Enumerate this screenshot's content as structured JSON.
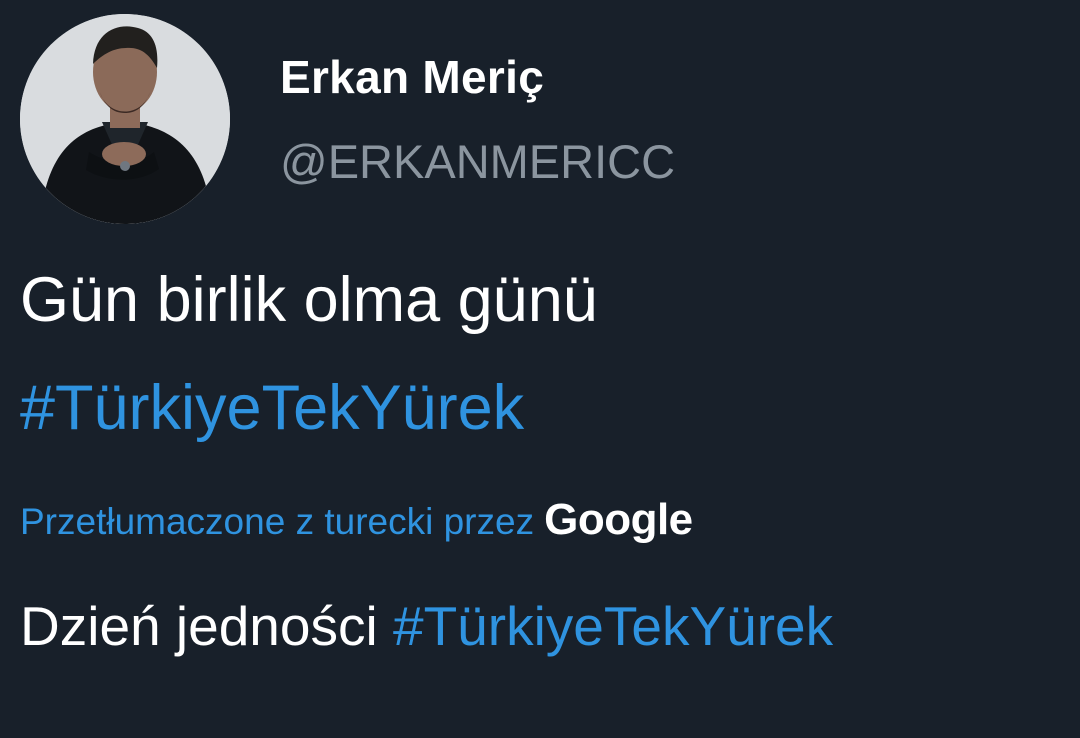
{
  "colors": {
    "background": "#18202a",
    "text": "#ffffff",
    "muted": "#8b959f",
    "link": "#2f93e0"
  },
  "author": {
    "display_name": "Erkan Meriç",
    "handle": "@ERKANMERICC",
    "avatar": "profile-photo"
  },
  "tweet": {
    "text": "Gün birlik olma günü",
    "hashtag": "#TürkiyeTekYürek"
  },
  "translation": {
    "note": "Przetłumaczone z turecki przez",
    "provider": "Google",
    "text": "Dzień jedności",
    "hashtag": "#TürkiyeTekYürek"
  }
}
